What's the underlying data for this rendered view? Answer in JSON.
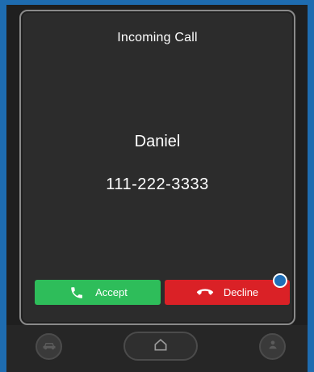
{
  "call": {
    "title": "Incoming Call",
    "caller_name": "Daniel",
    "caller_number": "111-222-3333"
  },
  "actions": {
    "accept_label": "Accept",
    "decline_label": "Decline",
    "accept_color": "#2ebd5a",
    "decline_color": "#da2126"
  },
  "icons": {
    "accept": "phone-icon",
    "decline": "hang-up-icon",
    "left_nav": "car-icon",
    "center_nav": "home-icon",
    "right_nav": "person-icon"
  },
  "colors": {
    "frame_accent": "#1e6cb0",
    "panel_background": "#2c2c2c",
    "text": "#ffffff"
  }
}
